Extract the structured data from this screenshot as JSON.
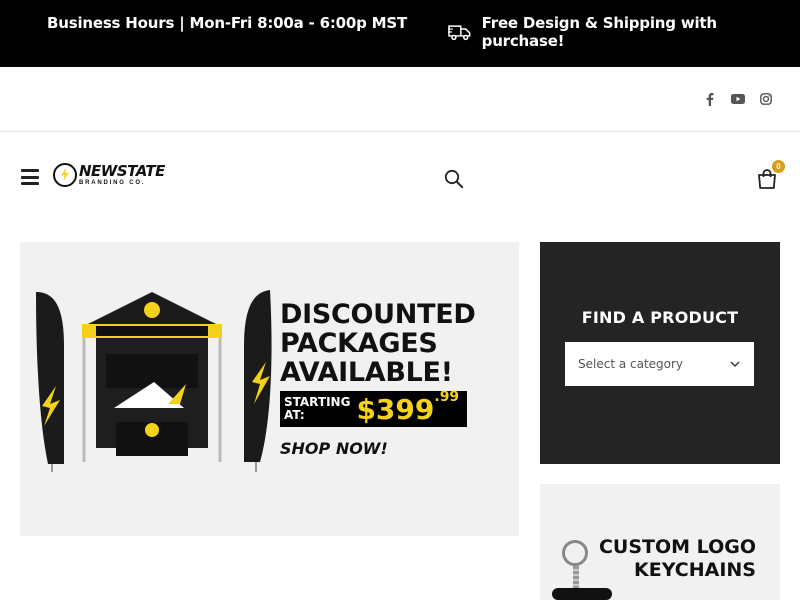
{
  "topbar": {
    "hours": "Business Hours | Mon-Fri 8:00a - 6:00p MST",
    "shipping": "Free Design & Shipping with purchase!",
    "shipping_icon": "truck-icon"
  },
  "social": {
    "icons": [
      "facebook-icon",
      "youtube-icon",
      "instagram-icon"
    ]
  },
  "header": {
    "menu_icon": "hamburger-icon",
    "logo": {
      "name": "NEWSTATE",
      "tagline": "BRANDING CO."
    },
    "search_icon": "search-icon",
    "cart_icon": "cart-bag-icon",
    "cart_count": "0"
  },
  "banner": {
    "headline_1": "DISCOUNTED",
    "headline_2": "PACKAGES",
    "headline_3": "AVAILABLE!",
    "starting_1": "STARTING",
    "starting_2": "AT:",
    "price": "$399",
    "price_cents": ".99",
    "cta": "SHOP NOW!"
  },
  "find_product": {
    "title": "FIND A PRODUCT",
    "select_value": "Select a category"
  },
  "keychains": {
    "line_1": "CUSTOM LOGO",
    "line_2": "KEYCHAINS"
  },
  "colors": {
    "accent": "#f4d21c",
    "badge": "#d99b1a",
    "dark_panel": "#242424"
  }
}
